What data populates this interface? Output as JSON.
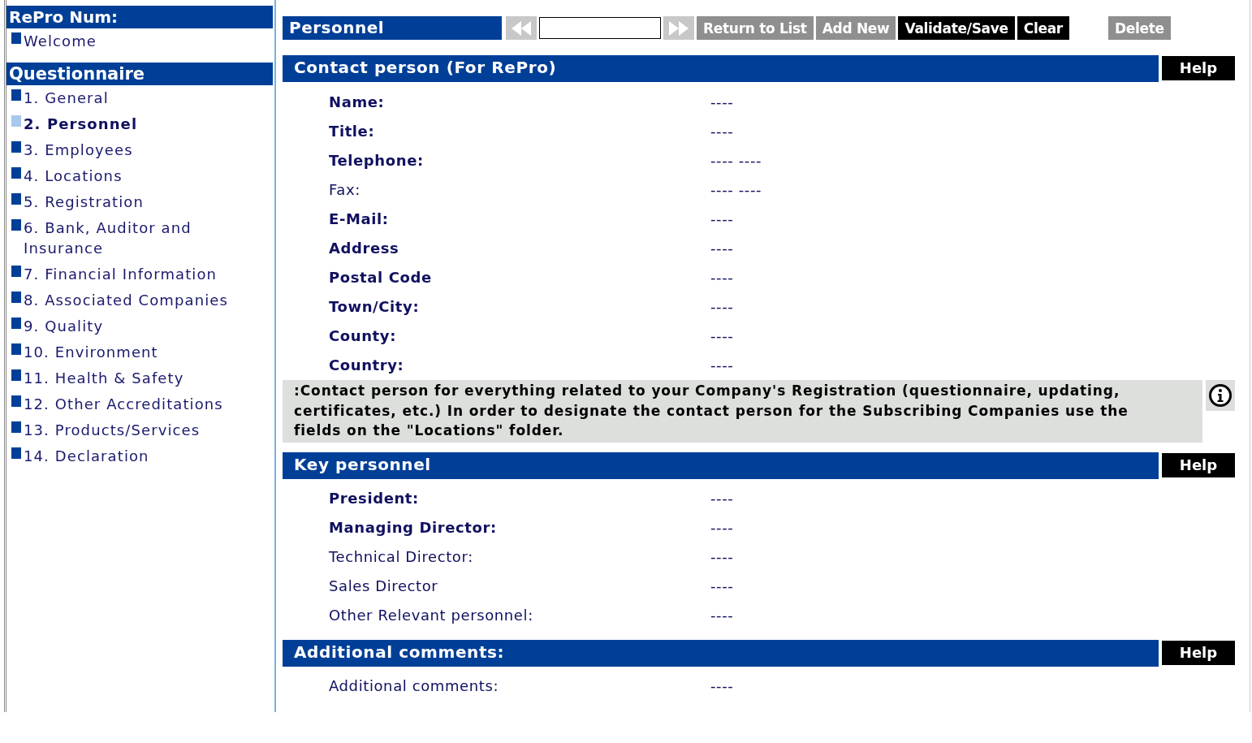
{
  "sidebar": {
    "header": "RePro Num:",
    "top_items": [
      {
        "label": "Welcome",
        "selected": false
      }
    ],
    "section_title": "Questionnaire",
    "items": [
      {
        "label": "1. General",
        "selected": false
      },
      {
        "label": "2. Personnel",
        "selected": true
      },
      {
        "label": "3. Employees",
        "selected": false
      },
      {
        "label": "4. Locations",
        "selected": false
      },
      {
        "label": "5. Registration",
        "selected": false
      },
      {
        "label": "6. Bank, Auditor and Insurance",
        "selected": false
      },
      {
        "label": "7. Financial Information",
        "selected": false
      },
      {
        "label": "8. Associated Companies",
        "selected": false
      },
      {
        "label": "9. Quality",
        "selected": false
      },
      {
        "label": "10. Environment",
        "selected": false
      },
      {
        "label": "11. Health & Safety",
        "selected": false
      },
      {
        "label": "12. Other Accreditations",
        "selected": false
      },
      {
        "label": "13. Products/Services",
        "selected": false
      },
      {
        "label": "14. Declaration",
        "selected": false
      }
    ]
  },
  "toolbar": {
    "title": "Personnel",
    "buttons": [
      {
        "kind": "first",
        "disabled": true
      },
      {
        "kind": "field"
      },
      {
        "kind": "last",
        "disabled": true
      },
      {
        "kind": "text",
        "label": "Return to List",
        "disabled": true
      },
      {
        "kind": "text",
        "label": "Add New",
        "disabled": true
      },
      {
        "kind": "text",
        "label": "Validate/Save",
        "disabled": false
      },
      {
        "kind": "text",
        "label": "Clear",
        "disabled": false
      },
      {
        "kind": "spacer"
      },
      {
        "kind": "text",
        "label": "Delete",
        "disabled": true
      }
    ]
  },
  "sections": [
    {
      "title": "Contact person (For RePro)",
      "help": "Help",
      "fields": [
        {
          "label": "Name:",
          "required": true,
          "value": "----"
        },
        {
          "label": "Title:",
          "required": true,
          "value": "----"
        },
        {
          "label": "Telephone:",
          "required": true,
          "value": "---- ----"
        },
        {
          "label": "Fax:",
          "required": false,
          "value": "---- ----"
        },
        {
          "label": "E-Mail:",
          "required": true,
          "value": "----"
        },
        {
          "label": "Address",
          "required": true,
          "value": "----"
        },
        {
          "label": "Postal Code",
          "required": true,
          "value": "----"
        },
        {
          "label": "Town/City:",
          "required": true,
          "value": "----"
        },
        {
          "label": "County:",
          "required": true,
          "value": "----"
        },
        {
          "label": "Country:",
          "required": true,
          "value": "----"
        }
      ],
      "note": ":Contact person for everything related to your Company's Registration (questionnaire, updating, certificates, etc.) In order to designate the contact person for the Subscribing Companies use the fields on the \"Locations\" folder."
    },
    {
      "title": "Key personnel",
      "help": "Help",
      "fields": [
        {
          "label": "President:",
          "required": true,
          "value": "----"
        },
        {
          "label": "Managing Director:",
          "required": true,
          "value": "----"
        },
        {
          "label": "Technical Director:",
          "required": false,
          "value": "----"
        },
        {
          "label": "Sales Director",
          "required": false,
          "value": "----"
        },
        {
          "label": "Other Relevant personnel:",
          "required": false,
          "value": "----"
        }
      ]
    },
    {
      "title": "Additional comments:",
      "help": "Help",
      "fields": [
        {
          "label": "Additional comments:",
          "required": false,
          "value": "----"
        }
      ]
    }
  ]
}
